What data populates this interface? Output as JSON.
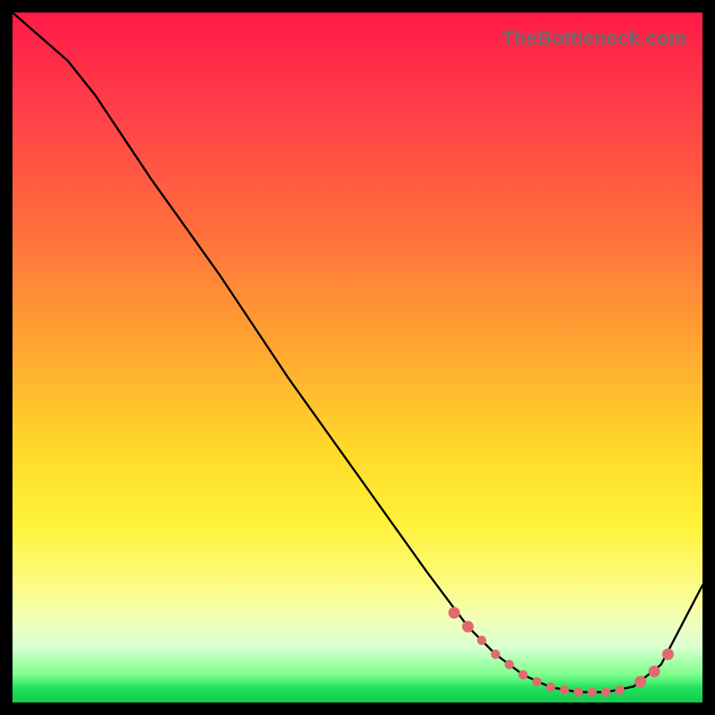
{
  "watermark": "TheBottleneck.com",
  "chart_data": {
    "type": "line",
    "title": "",
    "xlabel": "",
    "ylabel": "",
    "xlim": [
      0,
      100
    ],
    "ylim": [
      0,
      100
    ],
    "series": [
      {
        "name": "bottleneck-curve",
        "x": [
          0,
          8,
          12,
          20,
          30,
          40,
          50,
          60,
          66,
          70,
          74,
          78,
          82,
          86,
          90,
          94,
          100
        ],
        "y": [
          100,
          93,
          88,
          76,
          62,
          47,
          33,
          19,
          11,
          7,
          4,
          2.2,
          1.5,
          1.5,
          2.3,
          5.5,
          17
        ]
      }
    ],
    "markers": {
      "name": "highlighted-points",
      "color": "#e16a6f",
      "x": [
        64,
        66,
        68,
        70,
        72,
        74,
        76,
        78,
        80,
        82,
        84,
        86,
        88,
        91,
        93,
        95
      ],
      "y": [
        13,
        11,
        9,
        7,
        5.5,
        4,
        3,
        2.2,
        1.8,
        1.5,
        1.5,
        1.5,
        1.8,
        3,
        4.5,
        7
      ]
    }
  }
}
